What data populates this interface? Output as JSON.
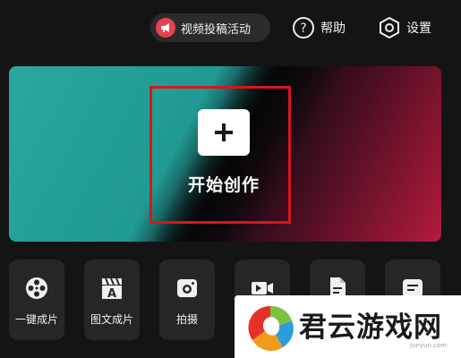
{
  "topbar": {
    "promo_label": "视频投稿活动",
    "help_label": "帮助",
    "settings_label": "设置"
  },
  "hero": {
    "create_label": "开始创作"
  },
  "tools": [
    {
      "label": "一键成片",
      "icon": "film-reel-icon"
    },
    {
      "label": "图文成片",
      "icon": "text-clapper-icon"
    },
    {
      "label": "拍摄",
      "icon": "camera-icon"
    },
    {
      "label": "",
      "icon": "video-record-icon"
    },
    {
      "label": "",
      "icon": "document-icon"
    },
    {
      "label": "",
      "icon": "note-card-icon"
    }
  ],
  "watermark": {
    "text": "君云游戏网",
    "sub": "junyun.com"
  },
  "colors": {
    "background": "#141414",
    "promo_accent": "#e8414f",
    "highlight_box": "#d8161c",
    "hero_teal": "#2aa79f",
    "hero_crimson": "#b41a3c"
  }
}
